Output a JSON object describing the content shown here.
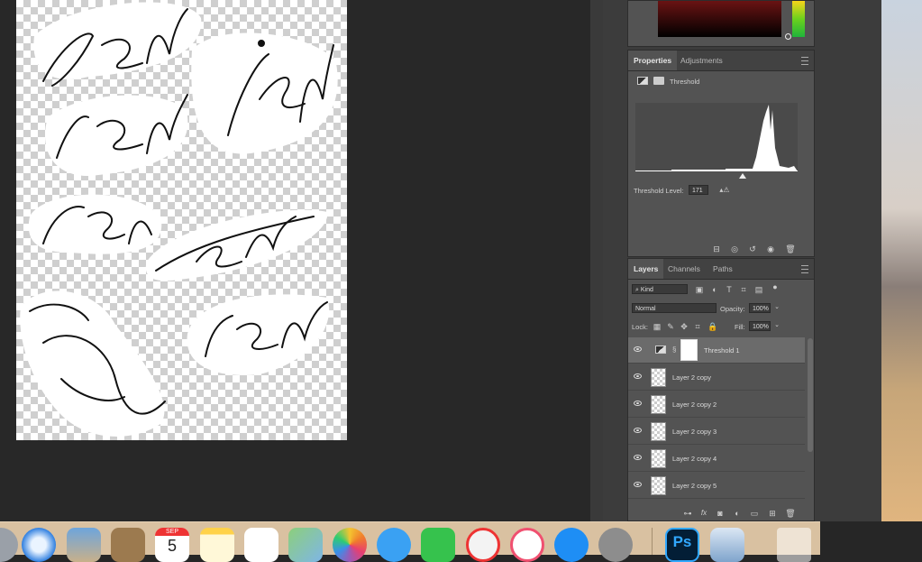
{
  "properties_panel": {
    "tabs": [
      "Properties",
      "Adjustments"
    ],
    "adjustment_name": "Threshold",
    "threshold_label": "Threshold Level:",
    "threshold_value": "171"
  },
  "layers_panel": {
    "tabs": [
      "Layers",
      "Channels",
      "Paths"
    ],
    "filter_kind": "Kind",
    "blend_mode": "Normal",
    "opacity_label": "Opacity:",
    "opacity_value": "100%",
    "lock_label": "Lock:",
    "fill_label": "Fill:",
    "fill_value": "100%",
    "layers": [
      {
        "name": "Threshold 1",
        "selected": true
      },
      {
        "name": "Layer 2 copy"
      },
      {
        "name": "Layer 2 copy 2"
      },
      {
        "name": "Layer 2 copy 3"
      },
      {
        "name": "Layer 2 copy 4"
      },
      {
        "name": "Layer 2 copy 5"
      }
    ]
  },
  "dock": {
    "calendar_month": "SEP",
    "calendar_day": "5",
    "photoshop_label": "Ps"
  },
  "colors": {
    "panel_bg": "#535353",
    "workspace_bg": "#282828",
    "dock_bg": "#d9c1a1"
  }
}
